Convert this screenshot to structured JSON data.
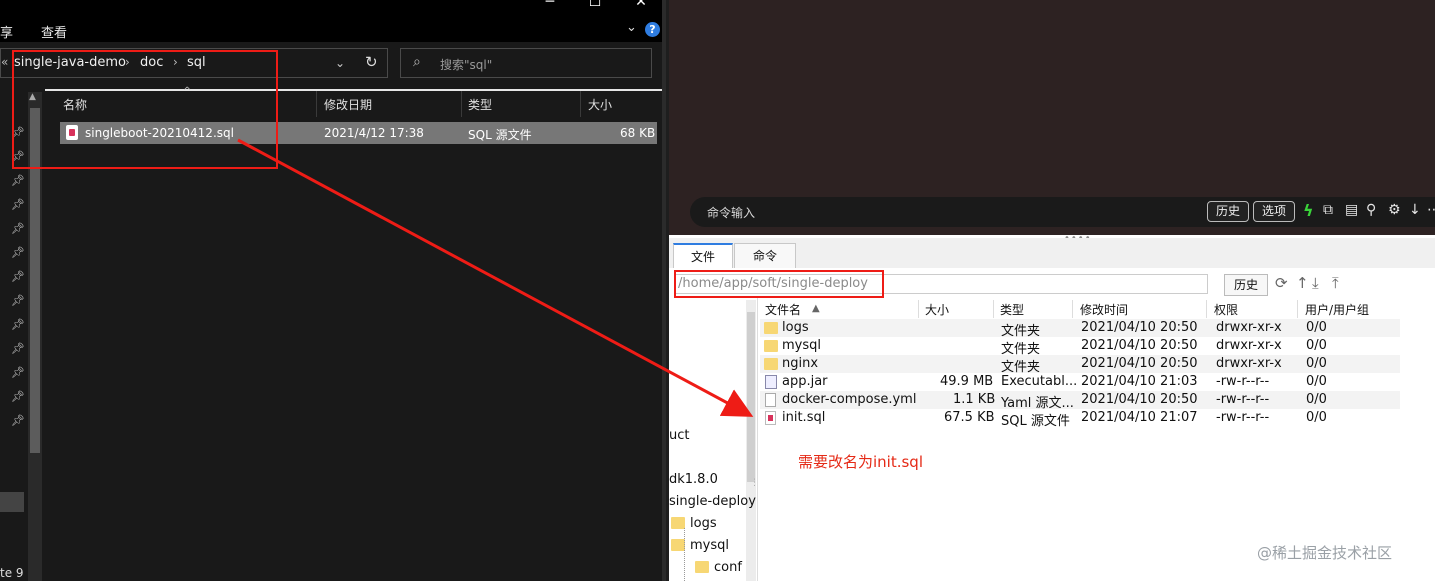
{
  "explorer": {
    "menu": [
      "享",
      "查看"
    ],
    "window_controls": [
      "─",
      "☐",
      "✕"
    ],
    "breadcrumb": [
      "single-java-demo",
      "doc",
      "sql"
    ],
    "breadcrumb_sep": "›",
    "search_placeholder": "搜索\"sql\"",
    "columns": [
      "名称",
      "修改日期",
      "类型",
      "大小"
    ],
    "file": {
      "name": "singleboot-20210412.sql",
      "modified": "2021/4/12 17:38",
      "type": "SQL 源文件",
      "size": "68 KB"
    },
    "status": "te 9"
  },
  "ssh": {
    "command_input_label": "命令输入",
    "history_button": "历史",
    "options_button": "选项",
    "tabs": [
      "文件",
      "命令"
    ],
    "path": "/home/app/soft/single-deploy",
    "path_history_button": "历史",
    "tree": {
      "items": [
        "uct",
        "dk1.8.0",
        "single-deploy",
        "logs",
        "mysql",
        "conf"
      ]
    },
    "table": {
      "columns": [
        "文件名",
        "大小",
        "类型",
        "修改时间",
        "权限",
        "用户/用户组"
      ],
      "rows": [
        {
          "icon": "folder-icon",
          "name": "logs",
          "size": "",
          "type": "文件夹",
          "modified": "2021/04/10 20:50",
          "perm": "drwxr-xr-x",
          "owner": "0/0"
        },
        {
          "icon": "folder-icon",
          "name": "mysql",
          "size": "",
          "type": "文件夹",
          "modified": "2021/04/10 20:50",
          "perm": "drwxr-xr-x",
          "owner": "0/0"
        },
        {
          "icon": "folder-icon",
          "name": "nginx",
          "size": "",
          "type": "文件夹",
          "modified": "2021/04/10 20:50",
          "perm": "drwxr-xr-x",
          "owner": "0/0"
        },
        {
          "icon": "jar-file-icon",
          "name": "app.jar",
          "size": "49.9 MB",
          "type": "Executabl...",
          "modified": "2021/04/10 21:03",
          "perm": "-rw-r--r--",
          "owner": "0/0"
        },
        {
          "icon": "yml-file-icon",
          "name": "docker-compose.yml",
          "size": "1.1 KB",
          "type": "Yaml 源文...",
          "modified": "2021/04/10 20:50",
          "perm": "-rw-r--r--",
          "owner": "0/0"
        },
        {
          "icon": "sql-file-icon",
          "name": "init.sql",
          "size": "67.5 KB",
          "type": "SQL 源文件",
          "modified": "2021/04/10 21:07",
          "perm": "-rw-r--r--",
          "owner": "0/0"
        }
      ]
    }
  },
  "annotation": {
    "note": "需要改名为init.sql",
    "color": "#ee1c16"
  },
  "watermark": "@稀土掘金技术社区"
}
